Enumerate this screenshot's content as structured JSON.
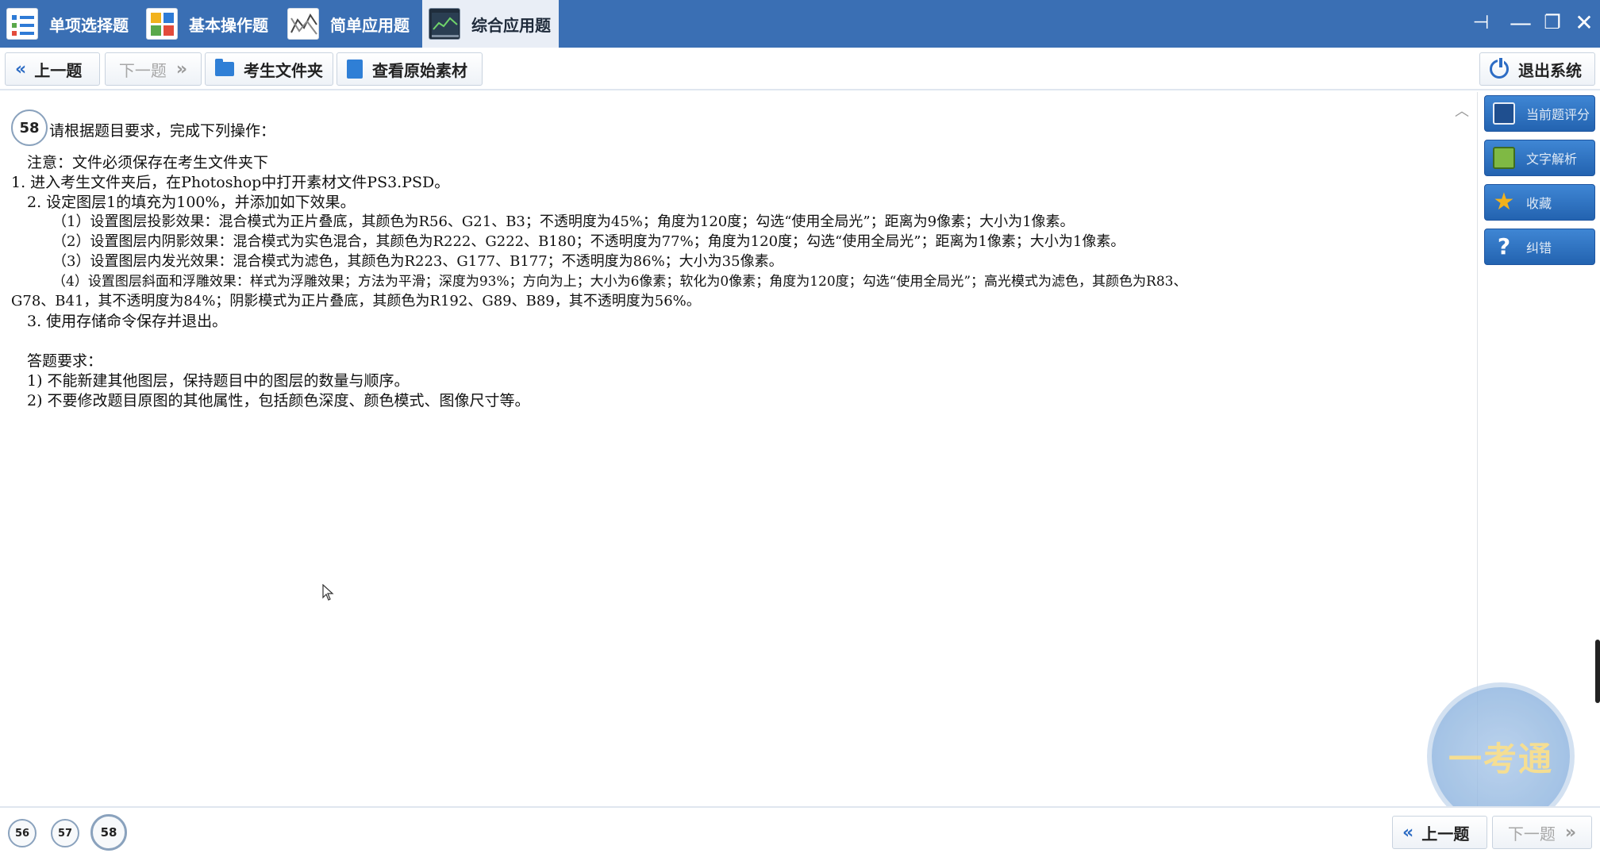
{
  "tabs": [
    {
      "label": "单项选择题",
      "icon": "list-icon",
      "active": false
    },
    {
      "label": "基本操作题",
      "icon": "grid-icon",
      "active": false
    },
    {
      "label": "简单应用题",
      "icon": "chart-icon",
      "active": false
    },
    {
      "label": "综合应用题",
      "icon": "image-icon",
      "active": true
    }
  ],
  "window_controls": {
    "pin": "⊣",
    "minimize": "—",
    "restore": "❐",
    "close": "✕"
  },
  "toolbar": {
    "prev_label": "上一题",
    "next_label": "下一题",
    "folder_label": "考生文件夹",
    "view_material_label": "查看原始素材",
    "exit_label": "退出系统"
  },
  "question": {
    "number": "58",
    "lines": [
      "请根据题目要求，完成下列操作：",
      "注意：文件必须保存在考生文件夹下",
      "1. 进入考生文件夹后，在Photoshop中打开素材文件PS3.PSD。",
      "2. 设定图层1的填充为100%，并添加如下效果。",
      "（1）设置图层投影效果：混合模式为正片叠底，其颜色为R56、G21、B3；不透明度为45%；角度为120度；勾选“使用全局光”；距离为9像素；大小为1像素。",
      "（2）设置图层内阴影效果：混合模式为实色混合，其颜色为R222、G222、B180；不透明度为77%；角度为120度；勾选“使用全局光”；距离为1像素；大小为1像素。",
      "（3）设置图层内发光效果：混合模式为滤色，其颜色为R223、G177、B177；不透明度为86%；大小为35像素。",
      "（4）设置图层斜面和浮雕效果：样式为浮雕效果；方法为平滑；深度为93%；方向为上；大小为6像素；软化为0像素；角度为120度；勾选“使用全局光”；高光模式为滤色，其颜色为R83、",
      "G78、B41，其不透明度为84%；阴影模式为正片叠底，其颜色为R192、G89、B89，其不透明度为56%。",
      "3. 使用存储命令保存并退出。",
      "答题要求：",
      "1) 不能新建其他图层，保持题目中的图层的数量与顺序。",
      "2) 不要修改题目原图的其他属性，包括颜色深度、颜色模式、图像尺寸等。"
    ]
  },
  "side_buttons": [
    {
      "label": "当前题评分",
      "icon": "save-icon",
      "color": "#1f4f8f"
    },
    {
      "label": "文字解析",
      "icon": "text-icon",
      "color": "#7fb944"
    },
    {
      "label": "收藏",
      "icon": "star-icon",
      "color": "#f2b21c"
    },
    {
      "label": "纠错",
      "icon": "help-icon",
      "color": "#ffffff"
    }
  ],
  "bottom_nav": {
    "questions": [
      "56",
      "57",
      "58"
    ],
    "current": "58",
    "prev_label": "上一题",
    "next_label": "下一题"
  },
  "watermark": "一考通",
  "colors": {
    "topbar": "#3a6fb4",
    "accent": "#2d6cc4"
  }
}
